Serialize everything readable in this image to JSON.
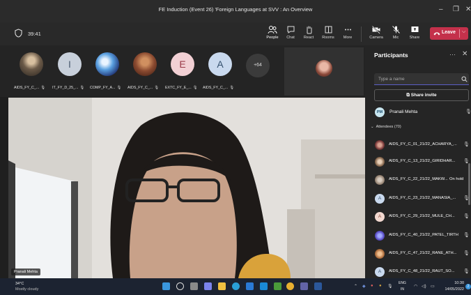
{
  "window": {
    "title": "FE Induction (Event 26) 'Foreign Languages at SVV : An Overview",
    "minimize": "–",
    "maximize": "❐",
    "close": "✕"
  },
  "toolbar": {
    "timer": "39:41",
    "people": "People",
    "chat": "Chat",
    "react": "React",
    "rooms": "Rooms",
    "more": "More",
    "camera": "Camera",
    "mic": "Mic",
    "share": "Share",
    "leave": "Leave",
    "leave_chevron": "⌵"
  },
  "strip": {
    "tiles": [
      {
        "name": "AIDS_FY_C_...",
        "initial": "",
        "color": "#6b5a48",
        "kind": "photo"
      },
      {
        "name": "IT_FY_D_25_...",
        "initial": "I",
        "color": "#c8d0db",
        "kind": "initial"
      },
      {
        "name": "COMP_FY_A...",
        "initial": "",
        "color": "#5aa0e0",
        "kind": "photo"
      },
      {
        "name": "AIDS_FY_C_...",
        "initial": "",
        "color": "#8a4a30",
        "kind": "photo"
      },
      {
        "name": "EXTC_FY_E_...",
        "initial": "E",
        "color": "#f2d0d4",
        "kind": "initial"
      },
      {
        "name": "AIDS_FY_C_...",
        "initial": "A",
        "color": "#c9d9ee",
        "kind": "initial"
      }
    ],
    "overflow": "+64"
  },
  "stage": {
    "speaker_name": "Pranali Mehta"
  },
  "participants": {
    "title": "Participants",
    "more": "···",
    "close": "✕",
    "search_placeholder": "Type a name",
    "share_invite": "Share invite",
    "organizer": {
      "initials": "PM",
      "name": "Pranali Mehta"
    },
    "attendees_label": "Attendees (70)",
    "rows": [
      {
        "name": "AIDS_FY_C_01_21/22_ACHARYA_...",
        "avatar": "",
        "color": "#7a3a3a",
        "status": ""
      },
      {
        "name": "AIDS_FY_C_13_21/22_GIRIDHAR...",
        "avatar": "",
        "color": "#8a6a50",
        "status": ""
      },
      {
        "name": "AIDS_FY_C_22_21/22_MAKW...",
        "avatar": "",
        "color": "#9a8878",
        "status": "On hold"
      },
      {
        "name": "AIDS_FY_C_23_21/22_MANASIA_...",
        "avatar": "A",
        "color": "#c9d9ee",
        "status": ""
      },
      {
        "name": "AIDS_FY_C_29_21/22_MULE_CH...",
        "avatar": "A",
        "color": "#f2d8d0",
        "status": ""
      },
      {
        "name": "AIDS_FY_C_40_21/22_PATEL_TIRTH",
        "avatar": "",
        "color": "#5b4fc7",
        "status": ""
      },
      {
        "name": "AIDS_FY_C_47_21/22_RANE_ATH...",
        "avatar": "",
        "color": "#b07040",
        "status": ""
      },
      {
        "name": "AIDS_FY_C_48_21/22_RAUT_SO...",
        "avatar": "A",
        "color": "#c9d9ee",
        "status": ""
      }
    ]
  },
  "taskbar": {
    "temperature": "34°C",
    "weather": "Mostly cloudy",
    "language": "ENG",
    "region": "IN",
    "time": "10:30",
    "date": "14/05/2022",
    "notifications": "2"
  }
}
